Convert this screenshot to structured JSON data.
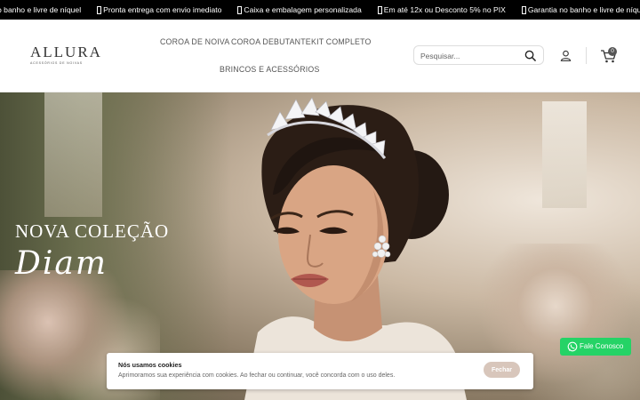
{
  "topbar": {
    "items": [
      "o banho e livre de níquel",
      "Pronta entrega com envio imediato",
      "Caixa e embalagem personalizada",
      "Em até 12x ou Desconto 5% no PIX",
      "Garantia no banho e livre de níquel"
    ]
  },
  "header": {
    "logo_text": "ALLURA",
    "logo_subtitle": "ACESSÓRIOS DE NOIVAS",
    "nav": [
      "COROA DE NOIVA",
      "COROA DEBUTANTE",
      "KIT COMPLETO",
      "BRINCOS E ACESSÓRIOS"
    ],
    "search_placeholder": "Pesquisar...",
    "cart_count": "0"
  },
  "hero": {
    "heading": "NOVA COLEÇÃO",
    "script_text": "Diam"
  },
  "cookie": {
    "title": "Nós usamos cookies",
    "text": "Aprimoramos sua experiência com cookies. Ao fechar ou continuar, você concorda com o uso deles.",
    "button": "Fechar"
  },
  "whatsapp": {
    "label": "Fale Conosco"
  },
  "colors": {
    "topbar_bg": "#000000",
    "whatsapp": "#25d366",
    "cookie_button": "#d8c6bb"
  }
}
